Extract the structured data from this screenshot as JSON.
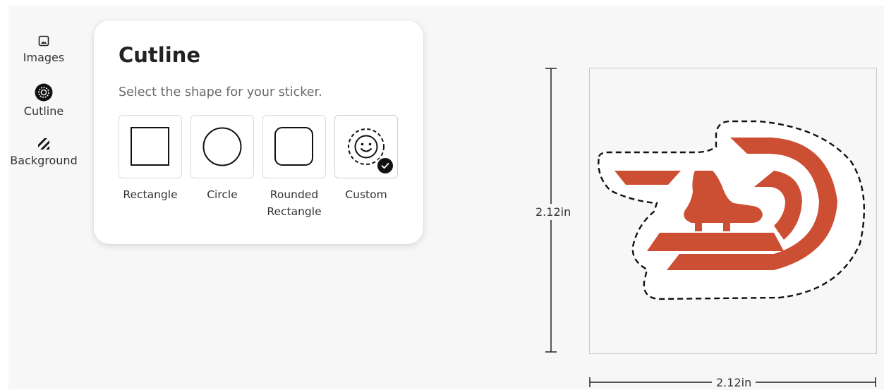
{
  "sidebar": {
    "items": [
      {
        "label": "Images",
        "icon": "image-icon"
      },
      {
        "label": "Cutline",
        "icon": "cutline-icon",
        "active": true
      },
      {
        "label": "Background",
        "icon": "background-icon"
      }
    ]
  },
  "panel": {
    "title": "Cutline",
    "subtitle": "Select the shape for your sticker.",
    "options": [
      {
        "label": "Rectangle",
        "icon": "square-icon"
      },
      {
        "label": "Circle",
        "icon": "circle-icon"
      },
      {
        "label": "Rounded Rectangle",
        "icon": "rounded-square-icon"
      },
      {
        "label": "Custom",
        "icon": "custom-smiley-icon",
        "selected": true
      }
    ]
  },
  "canvas": {
    "height_label": "2.12in",
    "width_label": "2.12in",
    "logo_color": "#cc4e33"
  }
}
